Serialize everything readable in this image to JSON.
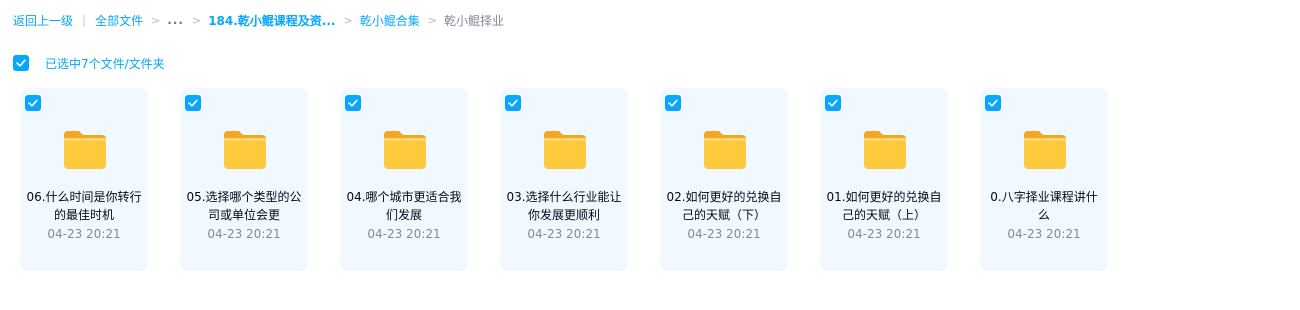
{
  "breadcrumb": {
    "back_label": "返回上一级",
    "root_label": "全部文件",
    "ellipsis": "...",
    "sep": ">",
    "bar": "|",
    "items": [
      {
        "label": "184.乾小鲲课程及资..."
      },
      {
        "label": "乾小鲲合集"
      }
    ],
    "current": "乾小鲲择业"
  },
  "selection": {
    "label": "已选中7个文件/文件夹",
    "checked": true
  },
  "colors": {
    "accent": "#06a7ff",
    "card_bg": "#f1f9fe",
    "folder_front": "#ffc93d",
    "folder_back": "#f5a623"
  },
  "files": [
    {
      "name": "06.什么时间是你转行的最佳时机",
      "date": "04-23 20:21",
      "icon": "folder-icon"
    },
    {
      "name": "05.选择哪个类型的公司或单位会更",
      "date": "04-23 20:21",
      "icon": "folder-icon"
    },
    {
      "name": "04.哪个城市更适合我们发展",
      "date": "04-23 20:21",
      "icon": "folder-icon"
    },
    {
      "name": "03.选择什么行业能让你发展更顺利",
      "date": "04-23 20:21",
      "icon": "folder-icon"
    },
    {
      "name": "02.如何更好的兑换自己的天赋（下）",
      "date": "04-23 20:21",
      "icon": "folder-icon"
    },
    {
      "name": "01.如何更好的兑换自己的天赋（上）",
      "date": "04-23 20:21",
      "icon": "folder-icon"
    },
    {
      "name": "0.八字择业课程讲什么",
      "date": "04-23 20:21",
      "icon": "folder-icon"
    }
  ]
}
